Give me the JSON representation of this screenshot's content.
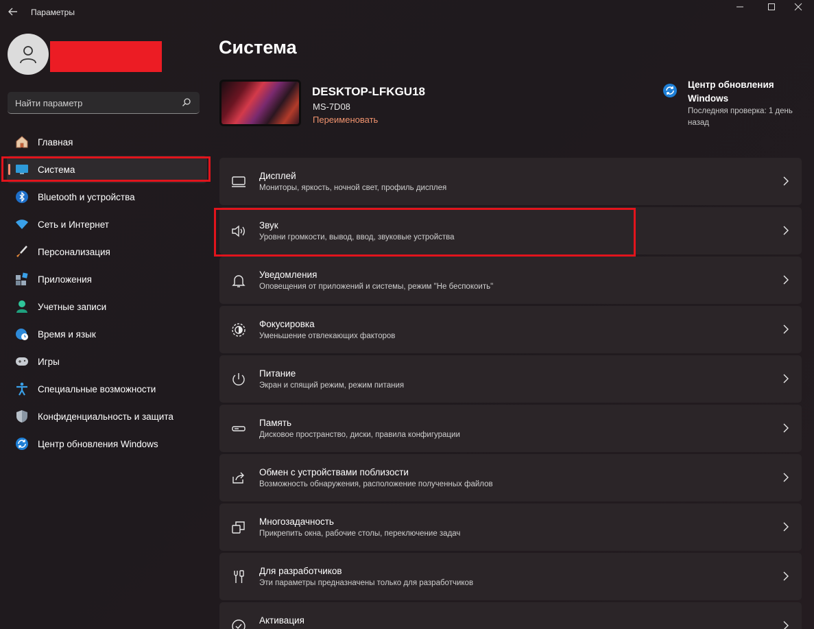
{
  "window": {
    "title": "Параметры"
  },
  "user": {
    "avatar_icon": "user-icon"
  },
  "search": {
    "placeholder": "Найти параметр",
    "icon": "search-icon"
  },
  "sidebar": {
    "items": [
      {
        "label": "Главная",
        "icon": "home-icon"
      },
      {
        "label": "Система",
        "icon": "monitor-icon",
        "active": true
      },
      {
        "label": "Bluetooth и устройства",
        "icon": "bluetooth-icon"
      },
      {
        "label": "Сеть и Интернет",
        "icon": "wifi-icon"
      },
      {
        "label": "Персонализация",
        "icon": "brush-icon"
      },
      {
        "label": "Приложения",
        "icon": "apps-icon"
      },
      {
        "label": "Учетные записи",
        "icon": "account-icon"
      },
      {
        "label": "Время и язык",
        "icon": "globe-clock-icon"
      },
      {
        "label": "Игры",
        "icon": "gamepad-icon"
      },
      {
        "label": "Специальные возможности",
        "icon": "accessibility-icon"
      },
      {
        "label": "Конфиденциальность и защита",
        "icon": "shield-icon"
      },
      {
        "label": "Центр обновления Windows",
        "icon": "update-icon"
      }
    ]
  },
  "main": {
    "title": "Система",
    "device": {
      "name": "DESKTOP-LFKGU18",
      "model": "MS-7D08",
      "rename_label": "Переименовать"
    },
    "update": {
      "title": "Центр обновления Windows",
      "subtitle": "Последняя проверка: 1 день назад"
    },
    "cards": [
      {
        "title": "Дисплей",
        "subtitle": "Мониторы, яркость, ночной свет, профиль дисплея",
        "icon": "display-icon"
      },
      {
        "title": "Звук",
        "subtitle": "Уровни громкости, вывод, ввод, звуковые устройства",
        "icon": "speaker-icon"
      },
      {
        "title": "Уведомления",
        "subtitle": "Оповещения от приложений и системы, режим \"Не беспокоить\"",
        "icon": "bell-icon"
      },
      {
        "title": "Фокусировка",
        "subtitle": "Уменьшение отвлекающих факторов",
        "icon": "focus-icon"
      },
      {
        "title": "Питание",
        "subtitle": "Экран и спящий режим, режим питания",
        "icon": "power-icon"
      },
      {
        "title": "Память",
        "subtitle": "Дисковое пространство, диски, правила конфигурации",
        "icon": "storage-icon"
      },
      {
        "title": "Обмен с устройствами поблизости",
        "subtitle": "Возможность обнаружения, расположение полученных файлов",
        "icon": "share-icon"
      },
      {
        "title": "Многозадачность",
        "subtitle": "Прикрепить окна, рабочие столы, переключение задач",
        "icon": "multitask-icon"
      },
      {
        "title": "Для разработчиков",
        "subtitle": "Эти параметры предназначены только для разработчиков",
        "icon": "developer-icon"
      },
      {
        "title": "Активация",
        "subtitle": "",
        "icon": "activation-icon"
      }
    ]
  },
  "colors": {
    "accent": "#ff8f73",
    "link": "#f0936e",
    "highlight": "#e1141c",
    "card": "#2b2528"
  }
}
